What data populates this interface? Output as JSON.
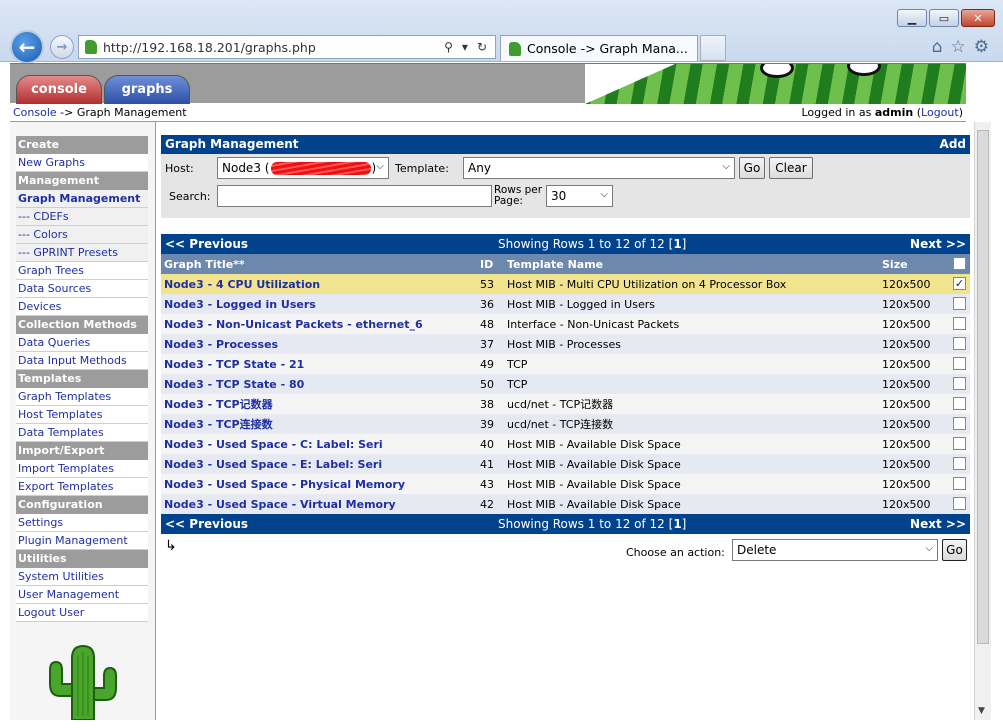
{
  "browser": {
    "url": "http://192.168.18.201/graphs.php",
    "tab_title": "Console -> Graph Mana...",
    "back_glyph": "←",
    "forward_glyph": "→",
    "search_glyph": "⚲",
    "refresh_glyph": "↻",
    "dropdown_glyph": "▾",
    "home_glyph": "⌂",
    "favorites_glyph": "☆",
    "tools_glyph": "⚙",
    "min_glyph": "▁",
    "max_glyph": "▭",
    "close_glyph": "✕"
  },
  "app": {
    "tabs": [
      "console",
      "graphs"
    ],
    "breadcrumb": {
      "link": "Console",
      "sep": " -> ",
      "current": "Graph Management"
    },
    "login": {
      "prefix": "Logged in as ",
      "user": "admin",
      "logout_open": " (",
      "logout": "Logout",
      "logout_close": ")"
    }
  },
  "sidebar": {
    "sections": [
      {
        "header": "Create",
        "items": [
          "New Graphs"
        ]
      },
      {
        "header": "Management",
        "items": [
          "Graph Management",
          "--- CDEFs",
          "--- Colors",
          "--- GPRINT Presets",
          "Graph Trees",
          "Data Sources",
          "Devices"
        ]
      },
      {
        "header": "Collection Methods",
        "items": [
          "Data Queries",
          "Data Input Methods"
        ]
      },
      {
        "header": "Templates",
        "items": [
          "Graph Templates",
          "Host Templates",
          "Data Templates"
        ]
      },
      {
        "header": "Import/Export",
        "items": [
          "Import Templates",
          "Export Templates"
        ]
      },
      {
        "header": "Configuration",
        "items": [
          "Settings",
          "Plugin Management"
        ]
      },
      {
        "header": "Utilities",
        "items": [
          "System Utilities",
          "User Management",
          "Logout User"
        ]
      }
    ],
    "active_item": "Graph Management"
  },
  "panel": {
    "title": "Graph Management",
    "add_label": "Add",
    "host_label": "Host:",
    "host_value": "Node3 (",
    "host_value_tail": ")",
    "template_label": "Template:",
    "template_value": "Any",
    "go_label": "Go",
    "clear_label": "Clear",
    "search_label": "Search:",
    "search_value": "",
    "rows_per_page_label": "Rows per Page:",
    "rows_per_page_value": "30"
  },
  "results": {
    "prev_label": "<< Previous",
    "next_label": ">>",
    "next_word": "Next",
    "showing_prefix": "Showing Rows 1 to 12 of 12 [",
    "showing_page": "1",
    "showing_suffix": "]",
    "columns": {
      "title": "Graph Title**",
      "id": "ID",
      "template": "Template Name",
      "size": "Size"
    },
    "rows": [
      {
        "title": "Node3 - 4 CPU Utilization",
        "id": "53",
        "template": "Host MIB - Multi CPU Utilization on 4 Processor Box",
        "size": "120x500",
        "checked": true
      },
      {
        "title": "Node3 - Logged in Users",
        "id": "36",
        "template": "Host MIB - Logged in Users",
        "size": "120x500",
        "checked": false
      },
      {
        "title": "Node3 - Non-Unicast Packets - ethernet_6",
        "id": "48",
        "template": "Interface - Non-Unicast Packets",
        "size": "120x500",
        "checked": false
      },
      {
        "title": "Node3 - Processes",
        "id": "37",
        "template": "Host MIB - Processes",
        "size": "120x500",
        "checked": false
      },
      {
        "title": "Node3 - TCP State - 21",
        "id": "49",
        "template": "TCP",
        "size": "120x500",
        "checked": false
      },
      {
        "title": "Node3 - TCP State - 80",
        "id": "50",
        "template": "TCP",
        "size": "120x500",
        "checked": false
      },
      {
        "title": "Node3 - TCP记数器",
        "id": "38",
        "template": "ucd/net - TCP记数器",
        "size": "120x500",
        "checked": false
      },
      {
        "title": "Node3 - TCP连接数",
        "id": "39",
        "template": "ucd/net - TCP连接数",
        "size": "120x500",
        "checked": false
      },
      {
        "title": "Node3 - Used Space - C: Label: Seri",
        "id": "40",
        "template": "Host MIB - Available Disk Space",
        "size": "120x500",
        "checked": false
      },
      {
        "title": "Node3 - Used Space - E: Label: Seri",
        "id": "41",
        "template": "Host MIB - Available Disk Space",
        "size": "120x500",
        "checked": false
      },
      {
        "title": "Node3 - Used Space - Physical Memory",
        "id": "43",
        "template": "Host MIB - Available Disk Space",
        "size": "120x500",
        "checked": false
      },
      {
        "title": "Node3 - Used Space - Virtual Memory",
        "id": "42",
        "template": "Host MIB - Available Disk Space",
        "size": "120x500",
        "checked": false
      }
    ],
    "action_arrow": "↳",
    "choose_action_label": "Choose an action:",
    "action_value": "Delete",
    "action_go": "Go"
  },
  "colors": {
    "header_blue": "#00438c",
    "column_header": "#6d88ad",
    "link_blue": "#1f2fa2",
    "selected_row": "#f2e38f",
    "menu_header": "#9c9c9c"
  }
}
